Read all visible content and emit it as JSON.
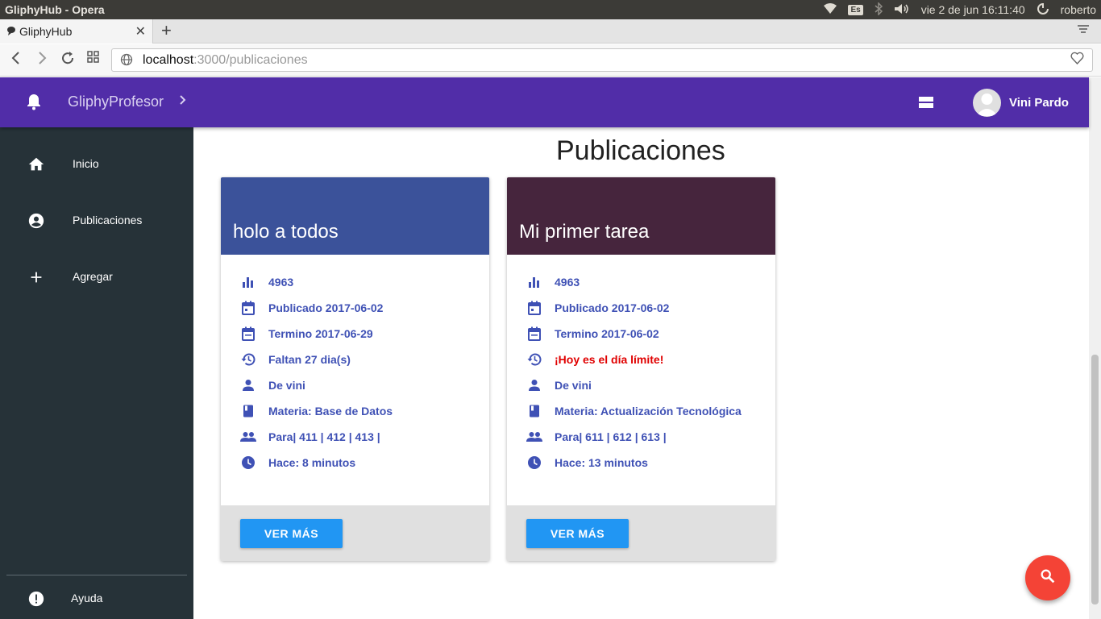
{
  "os": {
    "window_title": "GliphyHub - Opera",
    "keyboard_layout": "Es",
    "clock": "vie  2 de jun 16:11:40",
    "user": "roberto"
  },
  "browser": {
    "tab_title": "GliphyHub",
    "url_host": "localhost",
    "url_path": ":3000/publicaciones"
  },
  "appbar": {
    "brand": "GliphyProfesor",
    "user_name": "Vini Pardo",
    "color": "#512da8"
  },
  "sidebar": {
    "items": [
      {
        "label": "Inicio",
        "icon": "home-icon"
      },
      {
        "label": "Publicaciones",
        "icon": "account-circle-icon"
      },
      {
        "label": "Agregar",
        "icon": "plus-icon"
      }
    ],
    "help_label": "Ayuda"
  },
  "main": {
    "title": "Publicaciones",
    "cards": [
      {
        "title": "holo a todos",
        "header_color": "#3b529a",
        "views": "4963",
        "published": "Publicado 2017-06-02",
        "ends": "Termino 2017-06-29",
        "remaining": "Faltan 27 dia(s)",
        "author": "De vini",
        "subject": "Materia: Base de Datos",
        "groups": "Para| 411 | 412 | 413 |",
        "ago": "Hace: 8 minutos",
        "button": "VER MÁS"
      },
      {
        "title": "Mi primer tarea",
        "header_color": "#46253d",
        "views": "4963",
        "published": "Publicado 2017-06-02",
        "ends": "Termino 2017-06-02",
        "remaining": "¡Hoy es el día límite!",
        "author": "De vini",
        "subject": "Materia: Actualización Tecnológica",
        "groups": "Para| 611 | 612 | 613 |",
        "ago": "Hace: 13 minutos",
        "button": "VER MÁS"
      }
    ]
  },
  "colors": {
    "accent_text": "#3f51b5",
    "deadline_text": "#e00000",
    "button": "#2196f3",
    "fab": "#f44336",
    "sidebar": "#263238"
  }
}
